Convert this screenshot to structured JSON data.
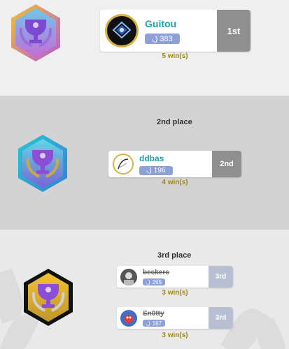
{
  "first": {
    "name": "Guitou",
    "elo": "383",
    "rank_label": "1st",
    "wins": "5 win(s)"
  },
  "second": {
    "title": "2nd place",
    "name": "ddbas",
    "elo": "196",
    "rank_label": "2nd",
    "wins": "4 win(s)"
  },
  "third": {
    "title": "3rd place",
    "players": [
      {
        "name": "beckerc",
        "elo": "265",
        "rank_label": "3rd",
        "wins": "3 win(s)"
      },
      {
        "name": "Sn0tty",
        "elo": "167",
        "rank_label": "3rd",
        "wins": "3 win(s)"
      }
    ]
  },
  "colors": {
    "name_teal": "#1aa3a3",
    "gold_text": "#a0870f",
    "elo_badge": "#8ea0d8",
    "rank_box": "#8f8f8f"
  },
  "icons": [
    "trophy-badge-gold-icon",
    "trophy-badge-teal-icon",
    "trophy-badge-black-icon",
    "elo-icon"
  ]
}
